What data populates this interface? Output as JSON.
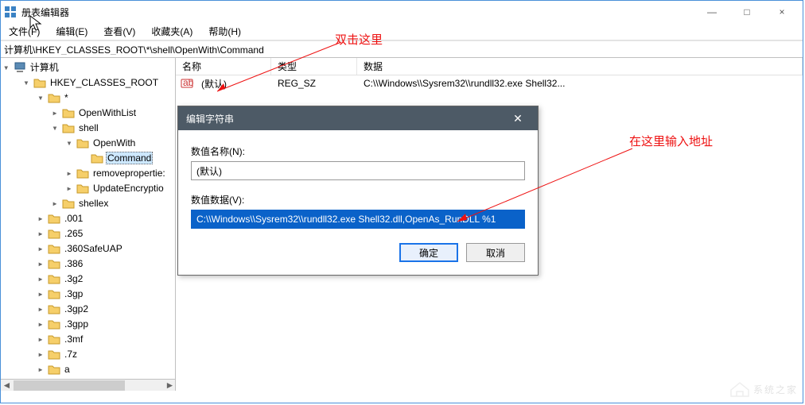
{
  "window": {
    "title": "册表编辑器",
    "min": "—",
    "max": "□",
    "close": "×"
  },
  "menubar": {
    "file": "文件(F)",
    "edit": "编辑(E)",
    "view": "查看(V)",
    "fav": "收藏夹(A)",
    "help": "帮助(H)"
  },
  "addressbar": {
    "path": "计算机\\HKEY_CLASSES_ROOT\\*\\shell\\OpenWith\\Command"
  },
  "tree": {
    "root": "计算机",
    "items": [
      {
        "indent": 0,
        "toggle": "v",
        "label": "HKEY_CLASSES_ROOT"
      },
      {
        "indent": 1,
        "toggle": "v",
        "label": "*"
      },
      {
        "indent": 2,
        "toggle": ">",
        "label": "OpenWithList"
      },
      {
        "indent": 2,
        "toggle": "v",
        "label": "shell"
      },
      {
        "indent": 3,
        "toggle": "v",
        "label": "OpenWith"
      },
      {
        "indent": 4,
        "toggle": " ",
        "label": "Command",
        "selected": true
      },
      {
        "indent": 3,
        "toggle": ">",
        "label": "removepropertie:"
      },
      {
        "indent": 3,
        "toggle": ">",
        "label": "UpdateEncryptio"
      },
      {
        "indent": 2,
        "toggle": ">",
        "label": "shellex"
      },
      {
        "indent": 1,
        "toggle": ">",
        "label": ".001"
      },
      {
        "indent": 1,
        "toggle": ">",
        "label": ".265"
      },
      {
        "indent": 1,
        "toggle": ">",
        "label": ".360SafeUAP"
      },
      {
        "indent": 1,
        "toggle": ">",
        "label": ".386"
      },
      {
        "indent": 1,
        "toggle": ">",
        "label": ".3g2"
      },
      {
        "indent": 1,
        "toggle": ">",
        "label": ".3gp"
      },
      {
        "indent": 1,
        "toggle": ">",
        "label": ".3gp2"
      },
      {
        "indent": 1,
        "toggle": ">",
        "label": ".3gpp"
      },
      {
        "indent": 1,
        "toggle": ">",
        "label": ".3mf"
      },
      {
        "indent": 1,
        "toggle": ">",
        "label": ".7z"
      },
      {
        "indent": 1,
        "toggle": ">",
        "label": "a"
      }
    ]
  },
  "columns": {
    "name": "名称",
    "type": "类型",
    "data": "数据",
    "w_name": 120,
    "w_type": 108,
    "w_data": 420
  },
  "rows": [
    {
      "name": "(默认)",
      "type": "REG_SZ",
      "data": "C:\\\\Windows\\\\Sysrem32\\\\rundll32.exe Shell32..."
    }
  ],
  "dialog": {
    "title": "编辑字符串",
    "name_label": "数值名称(N):",
    "name_value": "(默认)",
    "data_label": "数值数据(V):",
    "data_value": "C:\\\\Windows\\\\Sysrem32\\\\rundll32.exe Shell32.dll,OpenAs_RunDLL %1",
    "ok": "确定",
    "cancel": "取消"
  },
  "annotations": {
    "a1": "双击这里",
    "a2": "在这里输入地址"
  },
  "watermark": "系统之家"
}
